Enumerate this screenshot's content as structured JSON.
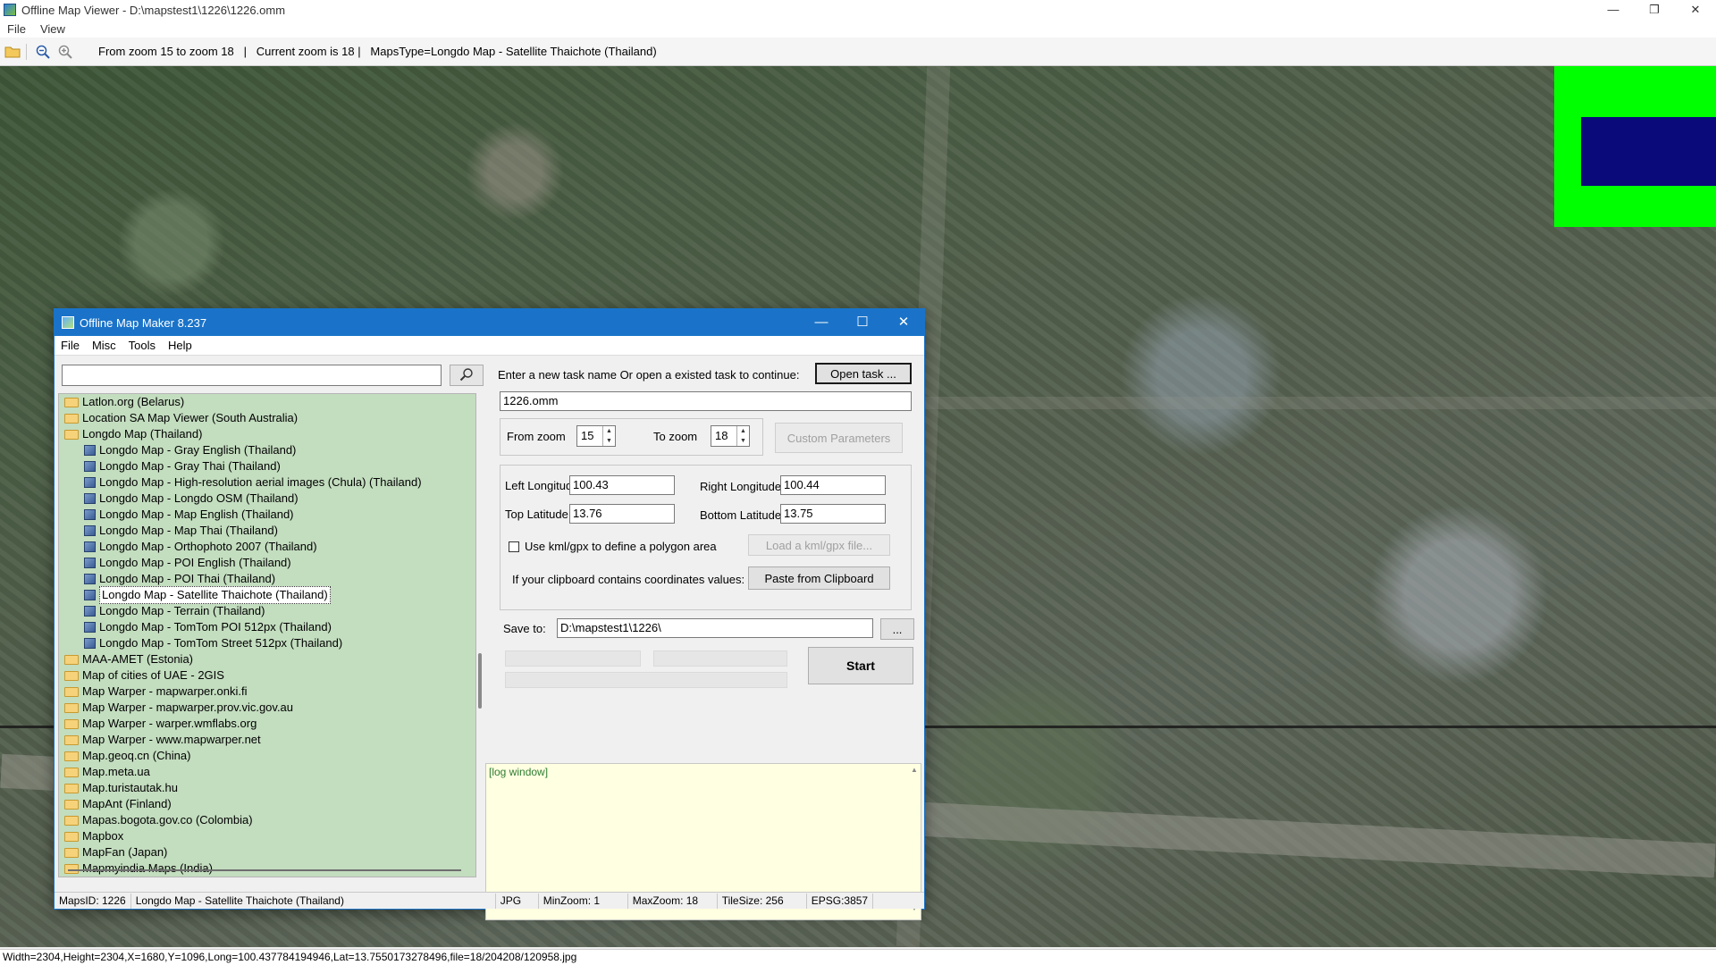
{
  "viewer": {
    "title": "Offline Map Viewer - D:\\mapstest1\\1226\\1226.omm",
    "window_controls": {
      "minimize": "—",
      "restore": "❐",
      "close": "✕"
    },
    "menu": {
      "file": "File",
      "view": "View"
    },
    "toolbar_status": "From zoom 15 to zoom 18   |   Current zoom is 18 |   MapsType=Longdo Map - Satellite Thaichote (Thailand)",
    "status_bar": "Width=2304,Height=2304,X=1680,Y=1096,Long=100.437784194946,Lat=13.7550173278496,file=18/204208/120958.jpg",
    "overview_colors": {
      "frame": "#00ff00",
      "viewport": "#0a0a7a"
    }
  },
  "dialog": {
    "title": "Offline Map Maker 8.237",
    "window_controls": {
      "minimize": "—",
      "maximize": "☐",
      "close": "✕"
    },
    "menu": {
      "file": "File",
      "misc": "Misc",
      "tools": "Tools",
      "help": "Help"
    },
    "search": {
      "value": "",
      "placeholder": ""
    },
    "tree": [
      {
        "label": "Latlon.org (Belarus)",
        "type": "folder"
      },
      {
        "label": "Location SA Map Viewer (South Australia)",
        "type": "folder"
      },
      {
        "label": "Longdo Map (Thailand)",
        "type": "folder-open"
      },
      {
        "label": "Longdo Map - Gray English (Thailand)",
        "type": "map"
      },
      {
        "label": "Longdo Map - Gray Thai (Thailand)",
        "type": "map"
      },
      {
        "label": "Longdo Map - High-resolution aerial images (Chula) (Thailand)",
        "type": "map"
      },
      {
        "label": "Longdo Map - Longdo OSM (Thailand)",
        "type": "map"
      },
      {
        "label": "Longdo Map - Map English (Thailand)",
        "type": "map"
      },
      {
        "label": "Longdo Map - Map Thai (Thailand)",
        "type": "map"
      },
      {
        "label": "Longdo Map - Orthophoto 2007 (Thailand)",
        "type": "map"
      },
      {
        "label": "Longdo Map - POI English (Thailand)",
        "type": "map"
      },
      {
        "label": "Longdo Map - POI Thai (Thailand)",
        "type": "map"
      },
      {
        "label": "Longdo Map - Satellite Thaichote (Thailand)",
        "type": "map",
        "selected": true
      },
      {
        "label": "Longdo Map - Terrain (Thailand)",
        "type": "map"
      },
      {
        "label": "Longdo Map - TomTom POI 512px (Thailand)",
        "type": "map"
      },
      {
        "label": "Longdo Map - TomTom Street 512px (Thailand)",
        "type": "map"
      },
      {
        "label": "MAA-AMET (Estonia)",
        "type": "folder"
      },
      {
        "label": "Map of cities of UAE - 2GIS",
        "type": "folder"
      },
      {
        "label": "Map Warper - mapwarper.onki.fi",
        "type": "folder"
      },
      {
        "label": "Map Warper - mapwarper.prov.vic.gov.au",
        "type": "folder"
      },
      {
        "label": "Map Warper - warper.wmflabs.org",
        "type": "folder"
      },
      {
        "label": "Map Warper - www.mapwarper.net",
        "type": "folder"
      },
      {
        "label": "Map.geoq.cn (China)",
        "type": "folder"
      },
      {
        "label": "Map.meta.ua",
        "type": "folder"
      },
      {
        "label": "Map.turistautak.hu",
        "type": "folder"
      },
      {
        "label": "MapAnt (Finland)",
        "type": "folder"
      },
      {
        "label": "Mapas.bogota.gov.co (Colombia)",
        "type": "folder"
      },
      {
        "label": "Mapbox",
        "type": "folder"
      },
      {
        "label": "MapFan (Japan)",
        "type": "folder"
      },
      {
        "label": "Mapmyindia Maps (India)",
        "type": "folder"
      }
    ],
    "task": {
      "prompt": "Enter a new task name Or open a existed task to continue:",
      "open_button": "Open task ...",
      "name_value": "1226.omm"
    },
    "zoom": {
      "from_label": "From zoom",
      "from_value": "15",
      "to_label": "To zoom",
      "to_value": "18",
      "custom_button": "Custom Parameters"
    },
    "coords": {
      "left_lon_label": "Left Longitude",
      "left_lon_value": "100.43",
      "right_lon_label": "Right Longitude",
      "right_lon_value": "100.44",
      "top_lat_label": "Top Latitude",
      "top_lat_value": "13.76",
      "bottom_lat_label": "Bottom Latitude",
      "bottom_lat_value": "13.75",
      "kml_label": "Use kml/gpx to define a polygon area",
      "kml_button": "Load a kml/gpx file...",
      "clipboard_label": "If your clipboard contains coordinates values:",
      "clipboard_button": "Paste from Clipboard"
    },
    "save": {
      "label": "Save to:",
      "value": "D:\\mapstest1\\1226\\",
      "browse_button": "..."
    },
    "start_button": "Start",
    "log_text": "[log window]",
    "status": {
      "maps_id": "MapsID: 1226",
      "map_name": "Longdo Map - Satellite Thaichote (Thailand)",
      "format": "JPG",
      "min_zoom": "MinZoom: 1",
      "max_zoom": "MaxZoom: 18",
      "tile_size": "TileSize: 256",
      "epsg": "EPSG:3857"
    }
  }
}
